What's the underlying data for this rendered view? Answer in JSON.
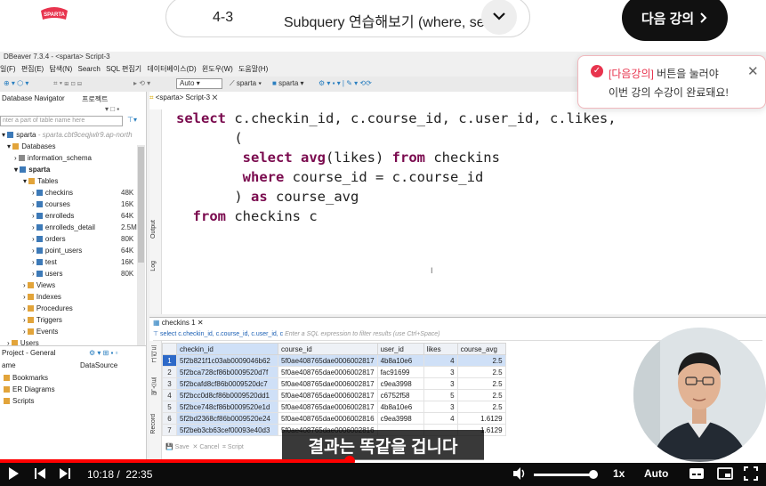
{
  "header": {
    "logo_text": "SPARTA",
    "lesson_number": "4-3",
    "lesson_title": "Subquery 연습해보기 (where, se",
    "next_button_label": "다음 강의"
  },
  "notification": {
    "line1_prefix": "[다음강의]",
    "line1_suffix": " 버튼을 눌러야",
    "line2": "이번 강의 수강이 완료돼요!"
  },
  "dbeaver": {
    "title": "DBeaver 7.3.4 - <sparta> Script-3",
    "menu": [
      "일(F)",
      "편집(E)",
      "탐색(N)",
      "Search",
      "SQL 편집기",
      "데이터베이스(D)",
      "윈도우(W)",
      "도움말(H)"
    ],
    "toolbar": {
      "auto_label": "Auto",
      "db1": "sparta",
      "db2": "sparta"
    },
    "navigator": {
      "tab1": "Database Navigator",
      "tab2": "프로젝트",
      "filter_placeholder": "nter a part of table name here",
      "connection": "sparta",
      "connection_host": "- sparta.cbt9ceqjwlr9.ap-north",
      "databases_label": "Databases",
      "schemas": [
        "information_schema",
        "sparta"
      ],
      "tables_label": "Tables",
      "tables": [
        {
          "name": "checkins",
          "size": "48K"
        },
        {
          "name": "courses",
          "size": "16K"
        },
        {
          "name": "enrolleds",
          "size": "64K"
        },
        {
          "name": "enrolleds_detail",
          "size": "2.5M"
        },
        {
          "name": "orders",
          "size": "80K"
        },
        {
          "name": "point_users",
          "size": "64K"
        },
        {
          "name": "test",
          "size": "16K"
        },
        {
          "name": "users",
          "size": "80K"
        }
      ],
      "folders": [
        "Views",
        "Indexes",
        "Procedures",
        "Triggers",
        "Events"
      ],
      "users_label": "Users"
    },
    "project": {
      "title": "Project - General",
      "col_name": "ame",
      "col_source": "DataSource",
      "items": [
        "Bookmarks",
        "ER Diagrams",
        "Scripts"
      ]
    },
    "editor": {
      "tab": "<sparta> Script-3",
      "side_tabs": [
        "Output",
        "Log"
      ]
    },
    "results": {
      "tab": "checkins 1",
      "filter_text": "select c.checkin_id, c.course_id, c.user_id, c",
      "filter_placeholder": "Enter a SQL expression to filter results (use Ctrl+Space)",
      "columns": [
        "checkin_id",
        "course_id",
        "user_id",
        "likes",
        "course_avg"
      ],
      "rows": [
        [
          "1",
          "5f2b821f1c03ab0009046b62",
          "5f0ae408765dae0006002817",
          "4b8a10e6",
          "4",
          "2.5"
        ],
        [
          "2",
          "5f2bca728cf86b0009520d7f",
          "5f0ae408765dae0006002817",
          "fac91699",
          "3",
          "2.5"
        ],
        [
          "3",
          "5f2bcafd8cf86b0009520dc7",
          "5f0ae408765dae0006002817",
          "c9ea3998",
          "3",
          "2.5"
        ],
        [
          "4",
          "5f2bcc0d8cf86b0009520dd1",
          "5f0ae408765dae0006002817",
          "c6752f58",
          "5",
          "2.5"
        ],
        [
          "5",
          "5f2bce748cf86b0009520e1d",
          "5f0ae408765dae0006002817",
          "4b8a10e6",
          "3",
          "2.5"
        ],
        [
          "6",
          "5f2bd2368cf86b0009520e24",
          "5f0ae408765dae0006002816",
          "c9ea3998",
          "4",
          "1.6129"
        ],
        [
          "7",
          "5f2beb3cb63cef00093e40d3",
          "5f0ae408765dae0006002816",
          "",
          "",
          "1.6129"
        ]
      ],
      "bottom_buttons": [
        "Save",
        "Cancel",
        "Script"
      ],
      "side_tabs": [
        "그리드",
        "텍스트",
        "Record"
      ]
    }
  },
  "subtitle": "결과는 똑같을 겁니다",
  "player": {
    "current_time": "10:18 /",
    "duration": "22:35",
    "speed": "1x",
    "quality": "Auto",
    "progress": 0.456,
    "volume": 0.95
  }
}
